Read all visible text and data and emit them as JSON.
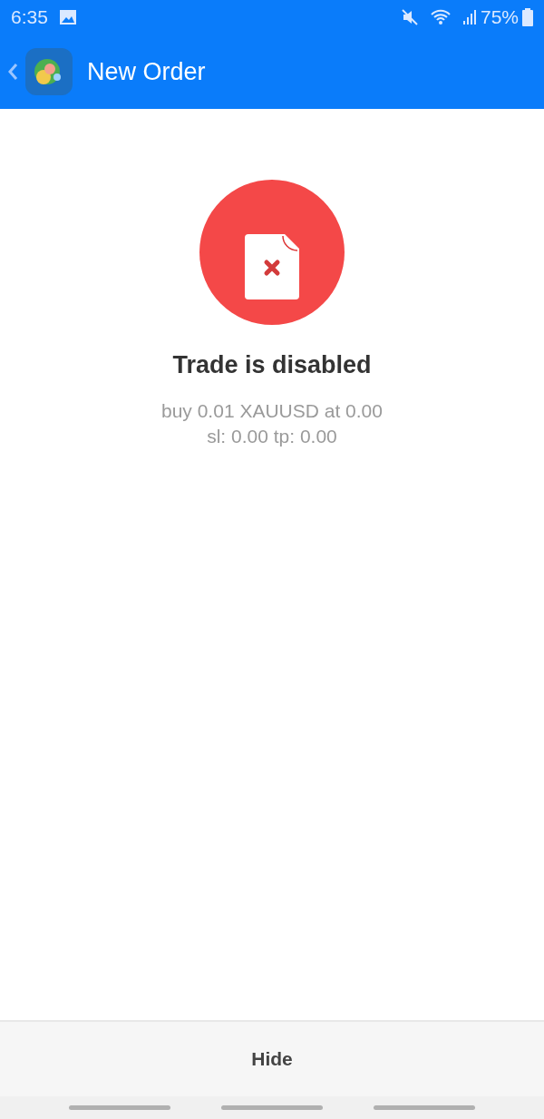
{
  "status_bar": {
    "time": "6:35",
    "battery": "75%"
  },
  "app_bar": {
    "title": "New Order"
  },
  "message": {
    "title": "Trade is disabled",
    "lines": [
      "buy 0.01 XAUUSD at 0.00",
      "sl: 0.00 tp: 0.00"
    ]
  },
  "buttons": [
    "Hide"
  ]
}
